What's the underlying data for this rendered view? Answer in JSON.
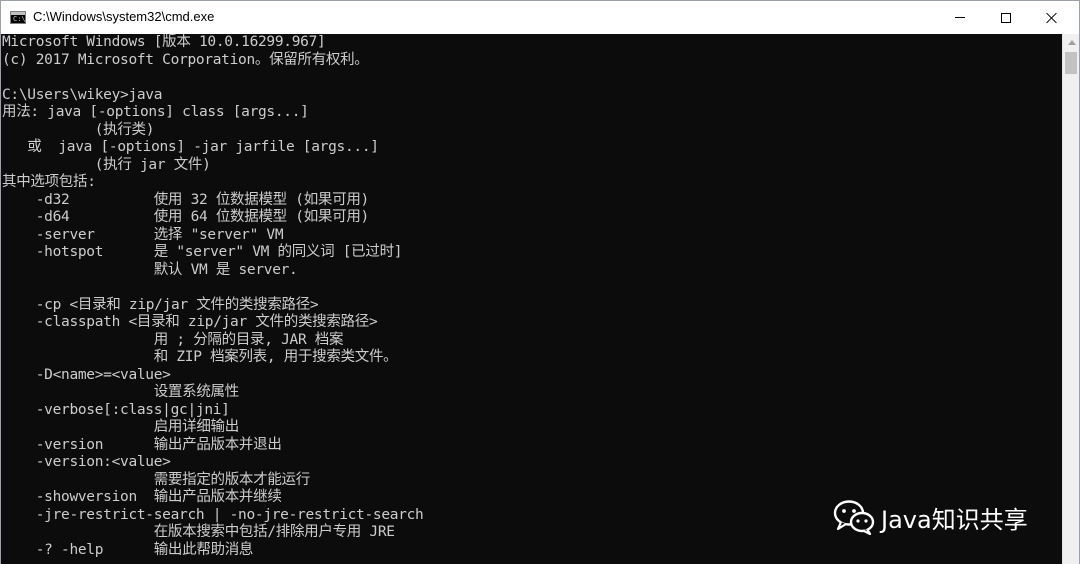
{
  "window": {
    "title": "C:\\Windows\\system32\\cmd.exe",
    "icon": "cmd-console-icon",
    "app_icon_text": "C:\\"
  },
  "title_controls": {
    "minimize_icon": "minimize-icon",
    "maximize_icon": "maximize-icon",
    "close_icon": "close-icon"
  },
  "console": {
    "background": "#0c0c0c",
    "foreground": "#cccccc",
    "lines": [
      "Microsoft Windows [版本 10.0.16299.967]",
      "(c) 2017 Microsoft Corporation。保留所有权利。",
      "",
      "C:\\Users\\wikey>java",
      "用法: java [-options] class [args...]",
      "           (执行类)",
      "   或  java [-options] -jar jarfile [args...]",
      "           (执行 jar 文件)",
      "其中选项包括:",
      "    -d32          使用 32 位数据模型 (如果可用)",
      "    -d64          使用 64 位数据模型 (如果可用)",
      "    -server       选择 \"server\" VM",
      "    -hotspot      是 \"server\" VM 的同义词 [已过时]",
      "                  默认 VM 是 server.",
      "",
      "    -cp <目录和 zip/jar 文件的类搜索路径>",
      "    -classpath <目录和 zip/jar 文件的类搜索路径>",
      "                  用 ; 分隔的目录, JAR 档案",
      "                  和 ZIP 档案列表, 用于搜索类文件。",
      "    -D<name>=<value>",
      "                  设置系统属性",
      "    -verbose[:class|gc|jni]",
      "                  启用详细输出",
      "    -version      输出产品版本并退出",
      "    -version:<value>",
      "                  需要指定的版本才能运行",
      "    -showversion  输出产品版本并继续",
      "    -jre-restrict-search | -no-jre-restrict-search",
      "                  在版本搜索中包括/排除用户专用 JRE",
      "    -? -help      输出此帮助消息"
    ]
  },
  "scrollbar": {
    "up_icon": "scroll-up-arrow-icon"
  },
  "watermark": {
    "icon": "wechat-logo-icon",
    "text": "Java知识共享"
  }
}
